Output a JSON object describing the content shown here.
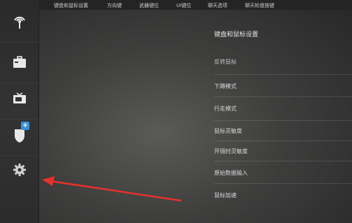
{
  "tabs": [
    {
      "label": "键盘和鼠标设置"
    },
    {
      "label": "方向键"
    },
    {
      "label": "武器键位"
    },
    {
      "label": "UI键位"
    },
    {
      "label": "聊天选项"
    },
    {
      "label": "聊天轮盘按键"
    }
  ],
  "sidebar": {
    "items": [
      {
        "icon": "antenna-icon"
      },
      {
        "icon": "briefcase-icon"
      },
      {
        "icon": "tv-icon"
      },
      {
        "icon": "shield-icon",
        "badge": "+"
      },
      {
        "icon": "gear-icon"
      }
    ]
  },
  "settings": {
    "title": "键盘和鼠标设置",
    "rows": [
      {
        "label": "反转鼠标"
      },
      {
        "label": "下蹲模式"
      },
      {
        "label": "行走模式"
      },
      {
        "label": "鼠标灵敏度"
      },
      {
        "label": "开镜时灵敏度"
      },
      {
        "label": "原始数据输入"
      },
      {
        "label": "鼠标加速"
      }
    ]
  },
  "annotation": {
    "color": "#e8312b"
  }
}
